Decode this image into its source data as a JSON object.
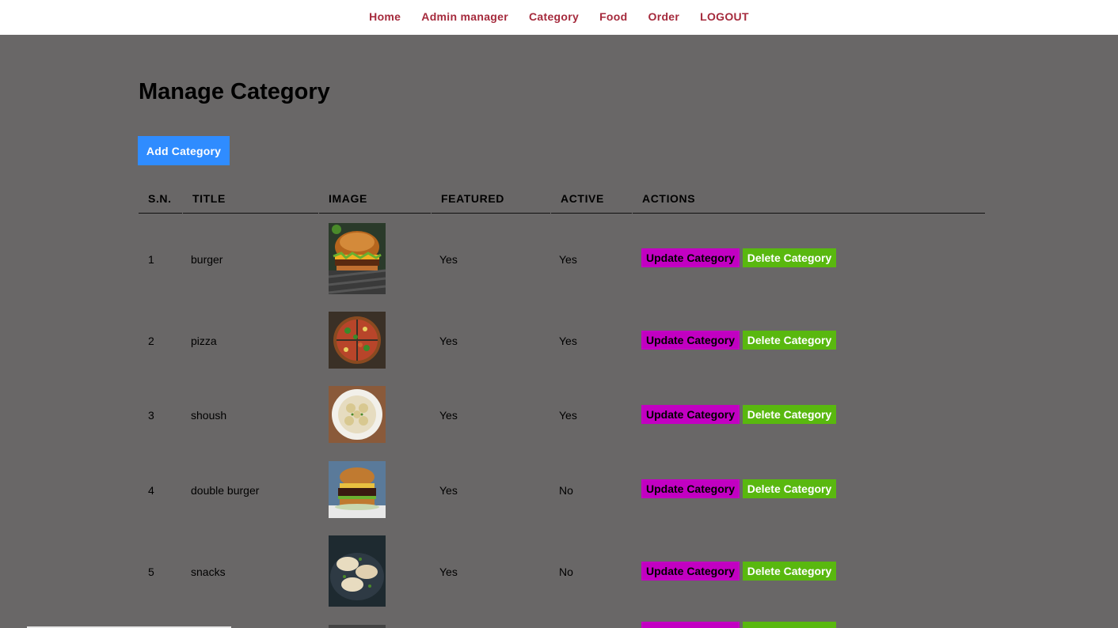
{
  "nav": {
    "items": [
      "Home",
      "Admin manager",
      "Category",
      "Food",
      "Order",
      "LOGOUT"
    ]
  },
  "page": {
    "title": "Manage Category",
    "add_button": "Add Category"
  },
  "table": {
    "columns": [
      "S.N.",
      "TITLE",
      "IMAGE",
      "FEATURED",
      "ACTIVE",
      "ACTIONS"
    ],
    "rows": [
      {
        "sn": "1",
        "title": "burger",
        "image": "burger-image",
        "featured": "Yes",
        "active": "Yes"
      },
      {
        "sn": "2",
        "title": "pizza",
        "image": "pizza-image",
        "featured": "Yes",
        "active": "Yes"
      },
      {
        "sn": "3",
        "title": "shoush",
        "image": "dumplings-plate-image",
        "featured": "Yes",
        "active": "Yes"
      },
      {
        "sn": "4",
        "title": "double burger",
        "image": "double-burger-image",
        "featured": "Yes",
        "active": "No"
      },
      {
        "sn": "5",
        "title": "snacks",
        "image": "momo-snacks-image",
        "featured": "Yes",
        "active": "No"
      }
    ],
    "update_label": "Update Category",
    "delete_label": "Delete Category"
  },
  "colors": {
    "background": "#696767",
    "nav_link": "#a52a3c",
    "add_button": "#2f8cff",
    "update_button": "#c200c2",
    "delete_button": "#59b80f"
  }
}
